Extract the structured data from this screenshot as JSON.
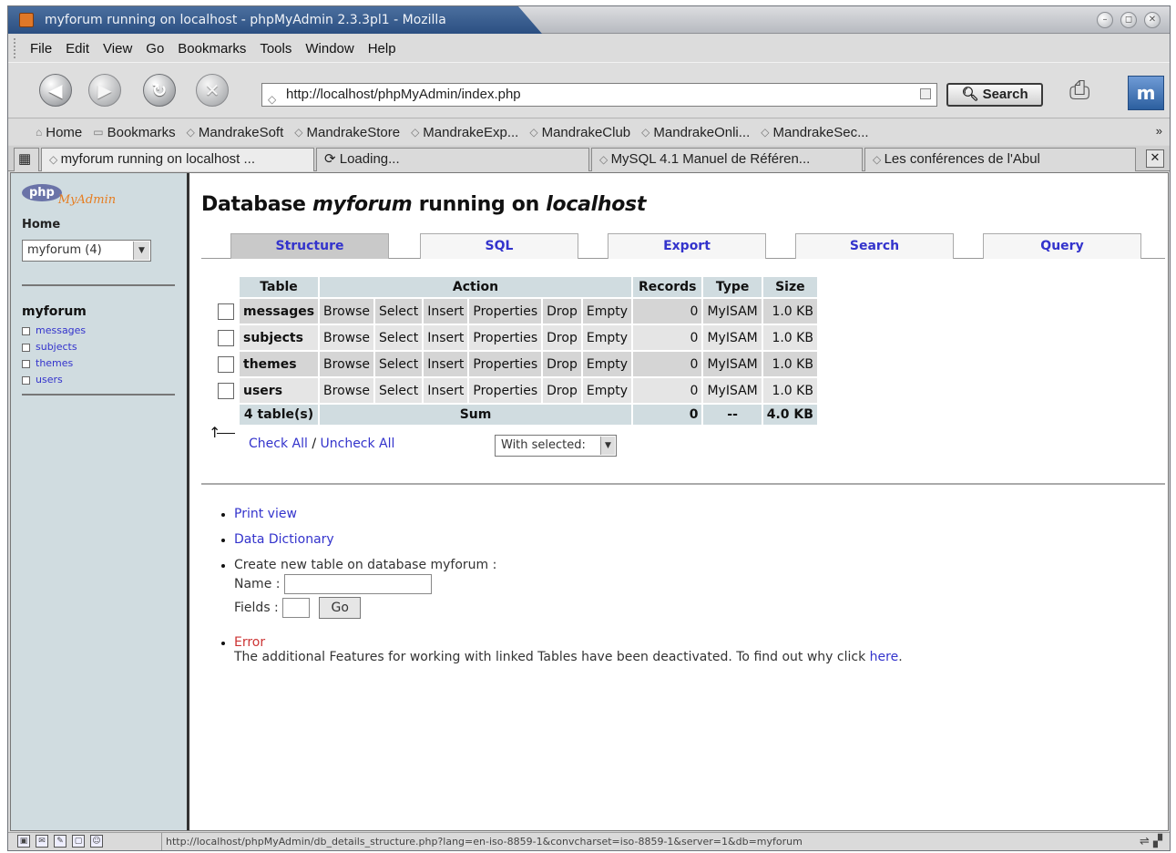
{
  "window": {
    "title": "myforum running on localhost - phpMyAdmin 2.3.3pl1 - Mozilla"
  },
  "menu": [
    "File",
    "Edit",
    "View",
    "Go",
    "Bookmarks",
    "Tools",
    "Window",
    "Help"
  ],
  "navbar": {
    "url": "http://localhost/phpMyAdmin/index.php",
    "search_label": "Search"
  },
  "bookmarks": [
    "Home",
    "Bookmarks",
    "MandrakeSoft",
    "MandrakeStore",
    "MandrakeExp...",
    "MandrakeClub",
    "MandrakeOnli...",
    "MandrakeSec..."
  ],
  "bookmarks_more": "»",
  "tabs": [
    {
      "label": "myforum running on localhost ..."
    },
    {
      "label": "Loading..."
    },
    {
      "label": "MySQL 4.1 Manuel de Référen..."
    },
    {
      "label": "Les conférences de l'Abul"
    }
  ],
  "left": {
    "logo_php": "php",
    "logo_myadmin": "MyAdmin",
    "home": "Home",
    "db_select": "myforum (4)",
    "db_name": "myforum",
    "tables": [
      "messages",
      "subjects",
      "themes",
      "users"
    ]
  },
  "main": {
    "title_prefix": "Database",
    "title_db": "myforum",
    "title_mid": "running on",
    "title_host": "localhost",
    "tabs": [
      "Structure",
      "SQL",
      "Export",
      "Search",
      "Query"
    ],
    "headers": {
      "table": "Table",
      "action": "Action",
      "records": "Records",
      "type": "Type",
      "size": "Size"
    },
    "actions": [
      "Browse",
      "Select",
      "Insert",
      "Properties",
      "Drop",
      "Empty"
    ],
    "rows": [
      {
        "name": "messages",
        "records": "0",
        "type": "MyISAM",
        "size": "1.0 KB"
      },
      {
        "name": "subjects",
        "records": "0",
        "type": "MyISAM",
        "size": "1.0 KB"
      },
      {
        "name": "themes",
        "records": "0",
        "type": "MyISAM",
        "size": "1.0 KB"
      },
      {
        "name": "users",
        "records": "0",
        "type": "MyISAM",
        "size": "1.0 KB"
      }
    ],
    "sum": {
      "tables": "4 table(s)",
      "label": "Sum",
      "records": "0",
      "type": "--",
      "size": "4.0 KB"
    },
    "check_all": "Check All",
    "separator": "/",
    "uncheck_all": "Uncheck All",
    "with_selected": "With selected:",
    "print_view": "Print view",
    "data_dictionary": "Data Dictionary",
    "create_table": "Create new table on database myforum :",
    "name_label": "Name :",
    "fields_label": "Fields :",
    "go": "Go",
    "error": "Error",
    "error_text": "The additional Features for working with linked Tables have been deactivated. To find out why click",
    "here": "here",
    "period": "."
  },
  "status": {
    "url": "http://localhost/phpMyAdmin/db_details_structure.php?lang=en-iso-8859-1&convcharset=iso-8859-1&server=1&db=myforum"
  }
}
